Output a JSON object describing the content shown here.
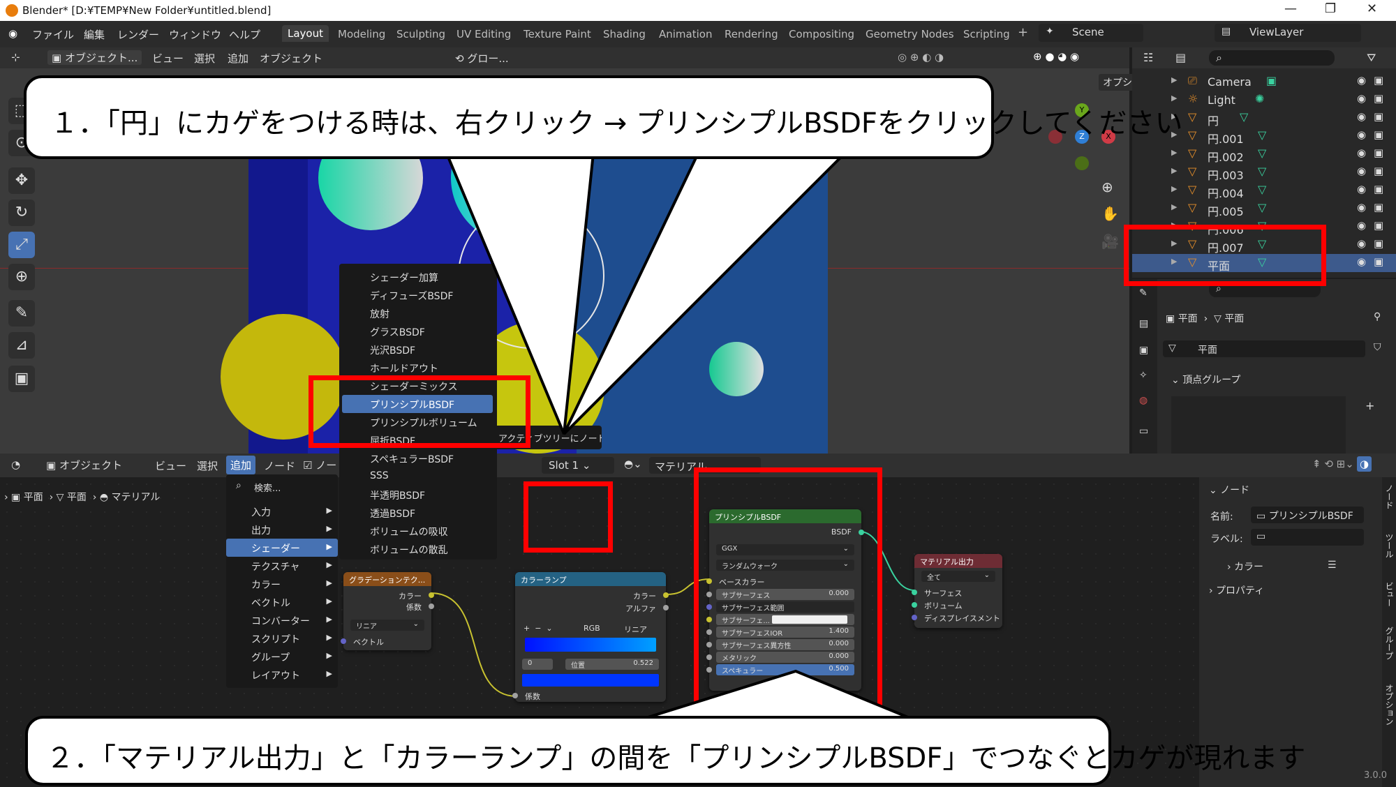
{
  "window": {
    "title": "Blender* [D:¥TEMP¥New Folder¥untitled.blend]",
    "version": "3.0.0"
  },
  "menu": [
    "ファイル",
    "編集",
    "レンダー",
    "ウィンドウ",
    "ヘルプ"
  ],
  "workspaces": [
    "Layout",
    "Modeling",
    "Sculpting",
    "UV Editing",
    "Texture Paint",
    "Shading",
    "Animation",
    "Rendering",
    "Compositing",
    "Geometry Nodes",
    "Scripting"
  ],
  "scene": {
    "name": "Scene",
    "view_layer": "ViewLayer"
  },
  "header3d": {
    "mode": "オブジェクト...",
    "items": [
      "ビュー",
      "選択",
      "追加",
      "オブジェクト"
    ],
    "transform": "グロー...",
    "options": "オプション"
  },
  "outliner": {
    "items": [
      {
        "name": "Camera"
      },
      {
        "name": "Light"
      },
      {
        "name": "円"
      },
      {
        "name": "円.001"
      },
      {
        "name": "円.002"
      },
      {
        "name": "円.003"
      },
      {
        "name": "円.004"
      },
      {
        "name": "円.005"
      },
      {
        "name": "円.006"
      },
      {
        "name": "円.007"
      },
      {
        "name": "平面",
        "selected": true
      }
    ]
  },
  "properties": {
    "breadcrumb_obj": "平面",
    "breadcrumb_mesh": "平面",
    "mesh_name": "平面",
    "section": "頂点グループ"
  },
  "shader_menu": {
    "items": [
      "シェーダー加算",
      "ディフューズBSDF",
      "放射",
      "グラスBSDF",
      "光沢BSDF",
      "ホールドアウト",
      "シェーダーミックス",
      "プリンシプルBSDF",
      "プリンシプルボリューム",
      "屈折BSDF",
      "スペキュラーBSDF",
      "SSS",
      "半透明BSDF",
      "透過BSDF",
      "ボリュームの吸収",
      "ボリュームの散乱"
    ],
    "selected": "プリンシプルBSDF",
    "tooltip": "アクティブツリーにノードを追加します。"
  },
  "add_menu": {
    "search": "検索...",
    "items": [
      "入力",
      "出力",
      "シェーダー",
      "テクスチャ",
      "カラー",
      "ベクトル",
      "コンバーター",
      "スクリプト",
      "グループ",
      "レイアウト"
    ],
    "selected": "シェーダー"
  },
  "node_header": {
    "mode": "オブジェクト",
    "items": [
      "ビュー",
      "選択",
      "追加",
      "ノード"
    ],
    "use_nodes": "ノー",
    "slot": "Slot 1",
    "material": "マテリアル"
  },
  "node_breadcrumb": [
    "平面",
    "平面",
    "マテリアル"
  ],
  "nodes": {
    "gradient": {
      "title": "グラデーションテク...",
      "out1": "カラー",
      "out2": "係数",
      "type": "リニア",
      "in": "ベクトル"
    },
    "colorramp": {
      "title": "カラーランプ",
      "out1": "カラー",
      "out2": "アルファ",
      "mode": "RGB",
      "interp": "リニア",
      "index": "0",
      "pos_label": "位置",
      "pos_value": "0.522",
      "in": "係数"
    },
    "principled": {
      "title": "プリンシプルBSDF",
      "out": "BSDF",
      "dist": "GGX",
      "sss_method": "ランダムウォーク",
      "base": "ベースカラー",
      "rows": [
        {
          "label": "サブサーフェス",
          "value": "0.000"
        },
        {
          "label": "サブサーフェス範囲",
          "value": ""
        },
        {
          "label": "サブサーフェ...",
          "value": ""
        },
        {
          "label": "サブサーフェスIOR",
          "value": "1.400"
        },
        {
          "label": "サブサーフェス異方性",
          "value": "0.000"
        },
        {
          "label": "メタリック",
          "value": "0.000"
        },
        {
          "label": "スペキュラー",
          "value": "0.500"
        }
      ]
    },
    "output": {
      "title": "マテリアル出力",
      "target": "全て",
      "in1": "サーフェス",
      "in2": "ボリューム",
      "in3": "ディスプレイスメント"
    }
  },
  "node_side": {
    "section": "ノード",
    "name_label": "名前:",
    "name_value": "プリンシプルBSDF",
    "label_label": "ラベル:",
    "color": "カラー",
    "props": "プロパティ",
    "tabs": [
      "ノード",
      "ツール",
      "ビュー",
      "グループ",
      "オプション"
    ]
  },
  "callouts": {
    "top": "１．「円」にカゲをつける時は、右クリック → プリンシプルBSDFをクリックしてください",
    "bottom": "２．「マテリアル出力」と「カラーランプ」の間を「プリンシプルBSDF」でつなぐとカゲが現れます"
  },
  "colors": {
    "accent": "#4772b3",
    "highlight": "#ff0000",
    "scene_bg": "#1b22a8"
  }
}
